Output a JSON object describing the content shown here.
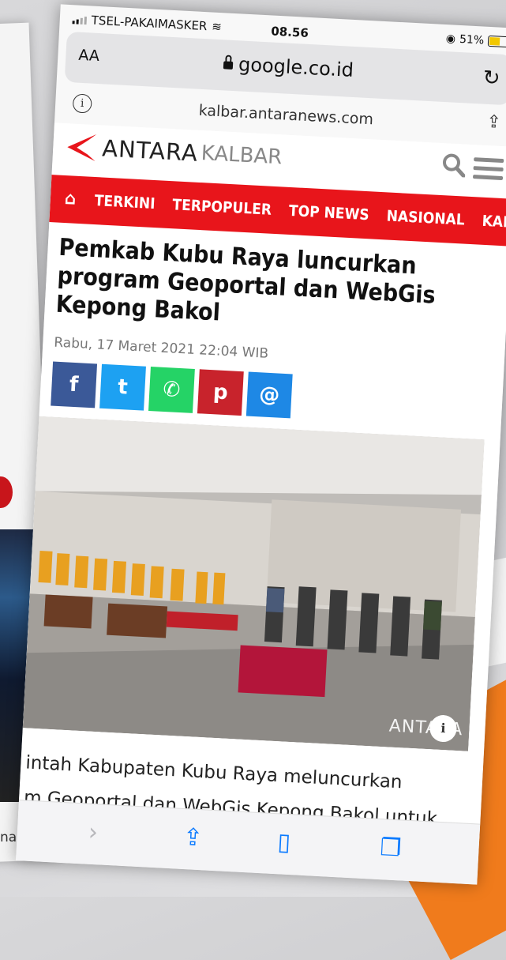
{
  "status": {
    "carrier": "TSEL-PAKAIMASKER",
    "time": "08.56",
    "battery_text": "51%",
    "battery_level": 0.51
  },
  "browser": {
    "text_size_label": "AA",
    "url": "google.co.id",
    "source_url": "kalbar.antaranews.com"
  },
  "site": {
    "logo_text": "ANTARA",
    "logo_sub": "KALBAR",
    "brand_color": "#e8151b",
    "nav": [
      "TERKINI",
      "TERPOPULER",
      "TOP NEWS",
      "NASIONAL",
      "KALBA"
    ]
  },
  "article": {
    "title": "Pemkab Kubu Raya luncurkan program Geoportal dan WebGis Kepong Bakol",
    "date": "Rabu, 17 Maret 2021 22:04 WIB",
    "share": [
      {
        "name": "facebook-icon",
        "glyph": "f",
        "color": "#3b5998"
      },
      {
        "name": "twitter-icon",
        "glyph": "t",
        "color": "#1da1f2"
      },
      {
        "name": "whatsapp-icon",
        "glyph": "✆",
        "color": "#25d366"
      },
      {
        "name": "pinterest-icon",
        "glyph": "p",
        "color": "#c8232c"
      },
      {
        "name": "email-icon",
        "glyph": "@",
        "color": "#1e88e5"
      }
    ],
    "photo_watermark": "ANTARA",
    "body_lines": [
      "intah Kabupaten Kubu Raya meluncurkan",
      "m Geoportal dan WebGis Kepong Bakol untuk"
    ]
  },
  "background": {
    "left_text": "nasi"
  }
}
